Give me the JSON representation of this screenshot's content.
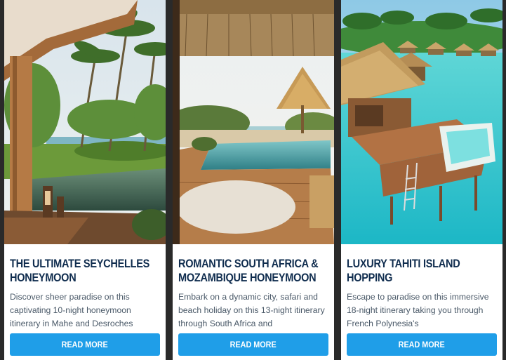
{
  "cards": [
    {
      "title": "THE ULTIMATE SEYCHELLES HONEYMOON",
      "description": "Discover sheer paradise on this captivating 10-night honeymoon itinerary in Mahe and Desroches",
      "button_label": "READ MORE",
      "image_name": "seychelles-villa-pool-photo"
    },
    {
      "title": "ROMANTIC SOUTH AFRICA & MOZAMBIQUE HONEYMOON",
      "description": "Embark on a dynamic city, safari and beach holiday on this 13-night itinerary through South Africa and",
      "button_label": "READ MORE",
      "image_name": "mozambique-beach-pool-photo"
    },
    {
      "title": "LUXURY TAHITI ISLAND HOPPING",
      "description": "Escape to paradise on this immersive 18-night itinerary taking you through French Polynesia's",
      "button_label": "READ MORE",
      "image_name": "tahiti-overwater-bungalow-photo"
    }
  ],
  "colors": {
    "title": "#0f2c4e",
    "button": "#1f9ee8",
    "background": "#2a2a2a"
  }
}
